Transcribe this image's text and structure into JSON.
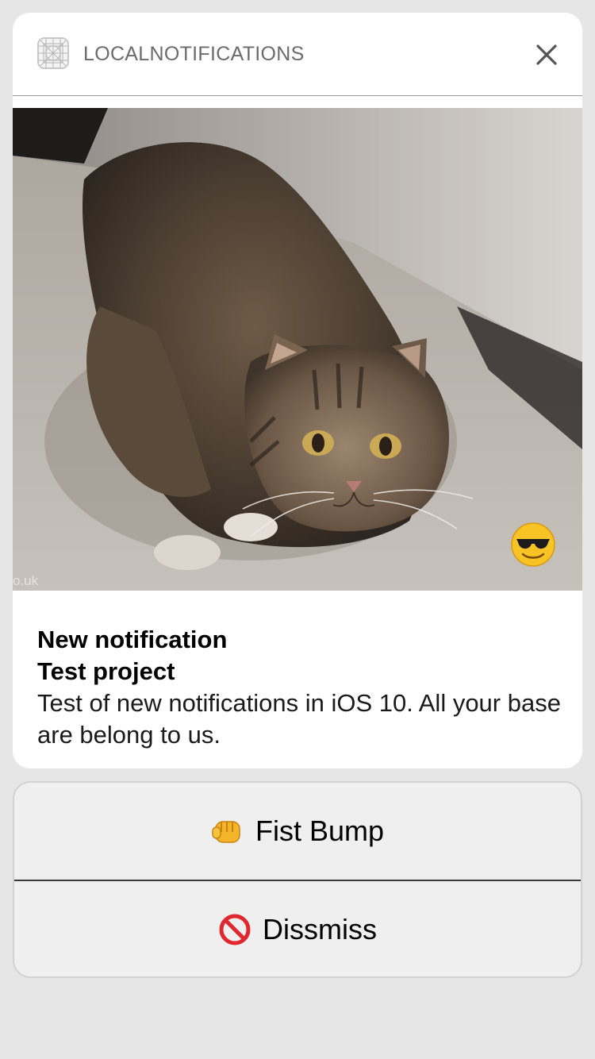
{
  "notification": {
    "app_name": "LOCALNOTIFICATIONS",
    "title": "New notification",
    "subtitle": "Test project",
    "body": "Test of new notifications in iOS 10. All your base are belong to us.",
    "image": {
      "description_icon": "cat-photo",
      "badge_icon": "sunglasses-emoji-icon",
      "watermark": "o.uk"
    }
  },
  "actions": [
    {
      "label": "Fist Bump",
      "icon": "fist-bump-emoji-icon"
    },
    {
      "label": "Dissmiss",
      "icon": "prohibited-emoji-icon"
    }
  ],
  "colors": {
    "background": "#e6e6e6",
    "card": "#ffffff",
    "action_panel": "#efefef",
    "app_name": "#6b6b6b"
  }
}
